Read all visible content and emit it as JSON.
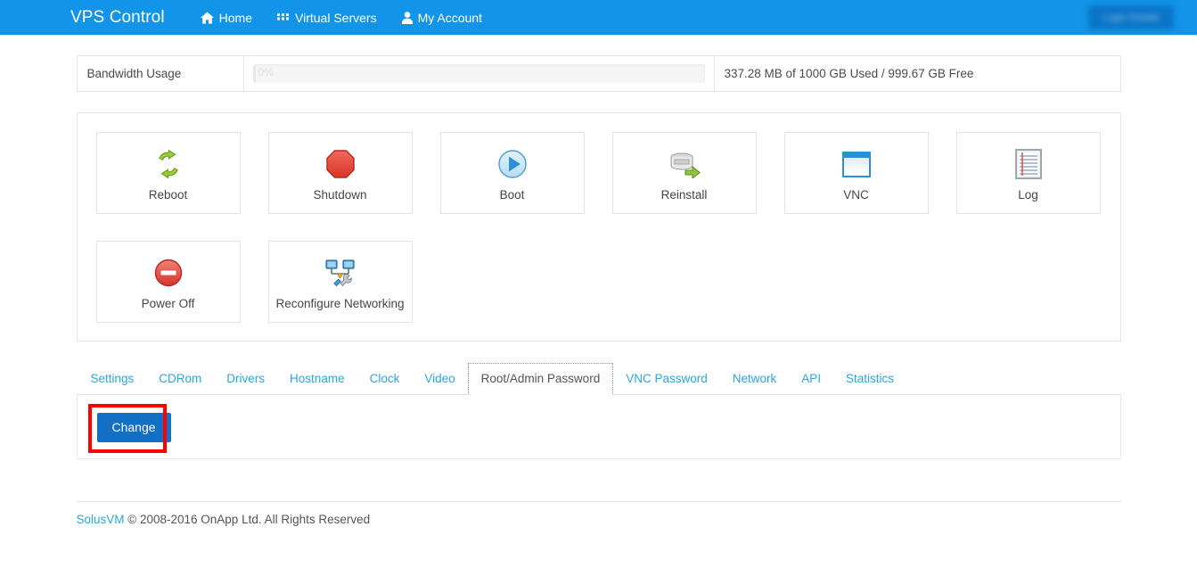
{
  "navbar": {
    "brand": "VPS Control",
    "links": [
      {
        "label": "Home",
        "icon": "home-icon"
      },
      {
        "label": "Virtual Servers",
        "icon": "grid-icon"
      },
      {
        "label": "My Account",
        "icon": "user-icon"
      }
    ],
    "right_button": {
      "label": "Login Details",
      "obscured": true
    },
    "bg_color": "#1295e9"
  },
  "bandwidth": {
    "label": "Bandwidth Usage",
    "percent_text": "0%",
    "percent_value": 0,
    "usage_text": "337.28 MB of 1000 GB Used / 999.67 GB Free"
  },
  "actions": [
    {
      "label": "Reboot",
      "icon": "reboot-icon"
    },
    {
      "label": "Shutdown",
      "icon": "shutdown-icon"
    },
    {
      "label": "Boot",
      "icon": "boot-icon"
    },
    {
      "label": "Reinstall",
      "icon": "reinstall-icon"
    },
    {
      "label": "VNC",
      "icon": "vnc-icon"
    },
    {
      "label": "Log",
      "icon": "log-icon"
    },
    {
      "label": "Power Off",
      "icon": "power-off-icon"
    },
    {
      "label": "Reconfigure Networking",
      "icon": "network-config-icon"
    }
  ],
  "tabs": [
    {
      "label": "Settings",
      "active": false
    },
    {
      "label": "CDRom",
      "active": false
    },
    {
      "label": "Drivers",
      "active": false
    },
    {
      "label": "Hostname",
      "active": false
    },
    {
      "label": "Clock",
      "active": false
    },
    {
      "label": "Video",
      "active": false
    },
    {
      "label": "Root/Admin Password",
      "active": true
    },
    {
      "label": "VNC Password",
      "active": false
    },
    {
      "label": "Network",
      "active": false
    },
    {
      "label": "API",
      "active": false
    },
    {
      "label": "Statistics",
      "active": false
    }
  ],
  "tab_content": {
    "change_button": "Change",
    "highlight_color": "#ff0000"
  },
  "footer": {
    "link": "SolusVM",
    "text": " © 2008-2016 OnApp Ltd. All Rights Reserved"
  },
  "colors": {
    "accent_blue": "#2ba6e0",
    "navbar_blue": "#1295e9",
    "button_blue": "#1170c4",
    "highlight_red": "#ff0000"
  }
}
